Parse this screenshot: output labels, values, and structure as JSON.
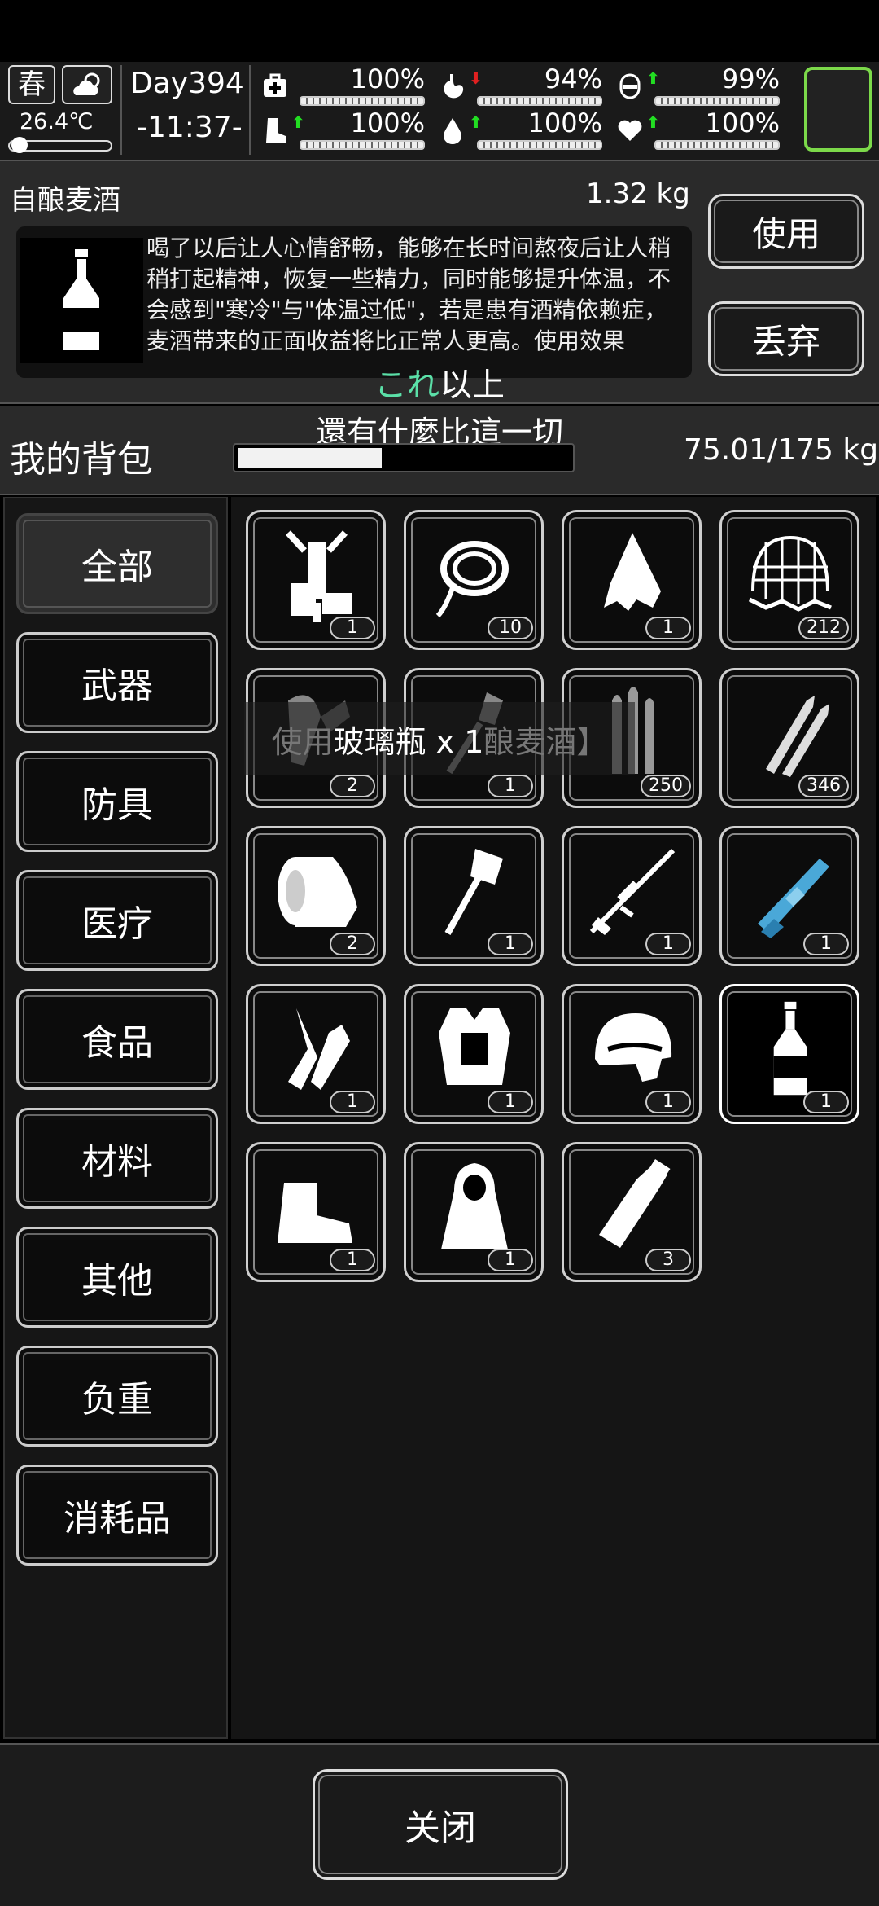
{
  "status": {
    "season": "春",
    "weather_icon": "partly-cloudy-icon",
    "temperature": "26.4℃",
    "day": "Day394",
    "time": "-11:37-",
    "stats": [
      {
        "name": "health",
        "icon": "medkit-icon",
        "arrow": "",
        "arrow_color": "",
        "percent": "100%",
        "level": 1.0
      },
      {
        "name": "hunger",
        "icon": "stomach-icon",
        "arrow": "⬇",
        "arrow_color": "#e02020",
        "percent": "94%",
        "level": 0.94
      },
      {
        "name": "energy",
        "icon": "capsule-icon",
        "arrow": "⬆",
        "arrow_color": "#22dd22",
        "percent": "99%",
        "level": 0.99
      },
      {
        "name": "stamina",
        "icon": "boot-icon",
        "arrow": "⬆",
        "arrow_color": "#22dd22",
        "percent": "100%",
        "level": 1.0
      },
      {
        "name": "thirst",
        "icon": "water-drop-icon",
        "arrow": "⬆",
        "arrow_color": "#22dd22",
        "percent": "100%",
        "level": 1.0
      },
      {
        "name": "mood",
        "icon": "heart-icon",
        "arrow": "⬆",
        "arrow_color": "#22dd22",
        "percent": "100%",
        "level": 1.0
      }
    ]
  },
  "detail": {
    "name": "自酿麦酒",
    "weight": "1.32 kg",
    "description": "喝了以后让人心情舒畅，能够在长时间熬夜后让人稍稍打起精神，恢复一些精力，同时能够提升体温，不会感到\"寒冷\"与\"体温过低\"，若是患有酒精依赖症，麦酒带来的正面收益将比正常人更高。使用效果",
    "use_label": "使用",
    "drop_label": "丢弃"
  },
  "subtitle": {
    "green": "これ",
    "white": "以上"
  },
  "bag": {
    "title": "我的背包",
    "overlay_text": "還有什麼比這一切",
    "capacity_fraction": 0.4286,
    "weight": "75.01/175 kg"
  },
  "categories": [
    "全部",
    "武器",
    "防具",
    "医疗",
    "食品",
    "材料",
    "其他",
    "负重",
    "消耗品"
  ],
  "items": [
    {
      "icon": "backpack-frame-icon",
      "count": "1"
    },
    {
      "icon": "rope-icon",
      "count": "10"
    },
    {
      "icon": "cloth-scrap-icon",
      "count": "1"
    },
    {
      "icon": "net-icon",
      "count": "212"
    },
    {
      "icon": "parts-icon",
      "count": "2"
    },
    {
      "icon": "shovel-icon",
      "count": "1"
    },
    {
      "icon": "bullets-icon",
      "count": "250"
    },
    {
      "icon": "rifle-rounds-icon",
      "count": "346"
    },
    {
      "icon": "bandage-roll-icon",
      "count": "2"
    },
    {
      "icon": "axe-icon",
      "count": "1"
    },
    {
      "icon": "sniper-rifle-icon",
      "count": "1"
    },
    {
      "icon": "minigun-icon",
      "count": "1"
    },
    {
      "icon": "gloves-icon",
      "count": "1"
    },
    {
      "icon": "body-armor-icon",
      "count": "1"
    },
    {
      "icon": "tactical-helmet-icon",
      "count": "1"
    },
    {
      "icon": "liquor-bottle-icon",
      "count": "1"
    },
    {
      "icon": "boots-icon",
      "count": "1"
    },
    {
      "icon": "cloak-icon",
      "count": "1"
    },
    {
      "icon": "glass-bottle-icon",
      "count": "3"
    }
  ],
  "selected_item_index": 15,
  "toast": {
    "prefix": "使用",
    "main": "玻璃瓶 x 1",
    "suffix": "酿麦酒】"
  },
  "footer": {
    "close_label": "关闭"
  }
}
